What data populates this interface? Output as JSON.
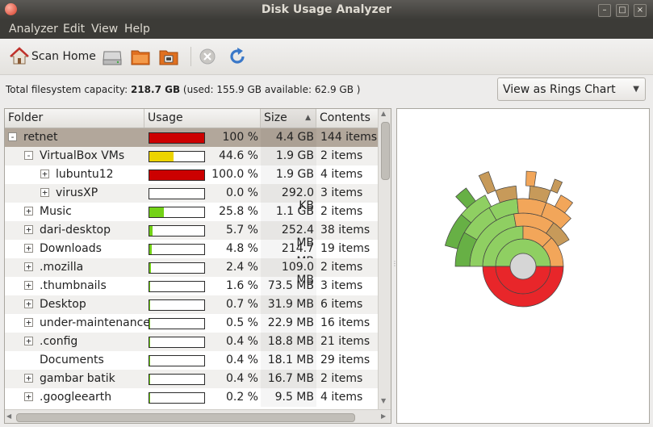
{
  "window": {
    "title": "Disk Usage Analyzer",
    "controls": [
      "–",
      "□",
      "×"
    ]
  },
  "menu": [
    "Analyzer",
    "Edit",
    "View",
    "Help"
  ],
  "toolbar": {
    "scan_home": "Scan Home"
  },
  "capacity": {
    "prefix": "Total filesystem capacity: ",
    "total": "218.7 GB",
    "detail": " (used: 155.9 GB available: 62.9 GB )"
  },
  "view_select": {
    "value": "View as Rings Chart"
  },
  "columns": [
    "Folder",
    "Usage",
    "Size",
    "Contents"
  ],
  "colors": {
    "red": "#cc0000",
    "yellow": "#edd400",
    "green": "#73d216",
    "selection": "#b2a79b"
  },
  "rows": [
    {
      "name": "retnet",
      "level": 0,
      "expander": "-",
      "fraction": 1.0,
      "color": "#cc0000",
      "percent": "100 %",
      "size": "4.4 GB",
      "contents": "144 items"
    },
    {
      "name": "VirtualBox VMs",
      "level": 1,
      "expander": "-",
      "fraction": 0.446,
      "color": "#edd400",
      "percent": "44.6 %",
      "size": "1.9 GB",
      "contents": "2 items"
    },
    {
      "name": "lubuntu12",
      "level": 2,
      "expander": "+",
      "fraction": 1.0,
      "color": "#cc0000",
      "percent": "100.0 %",
      "size": "1.9 GB",
      "contents": "4 items"
    },
    {
      "name": "virusXP",
      "level": 2,
      "expander": "+",
      "fraction": 0.0,
      "color": "#73d216",
      "percent": "0.0 %",
      "size": "292.0 KB",
      "contents": "3 items"
    },
    {
      "name": "Music",
      "level": 1,
      "expander": "+",
      "fraction": 0.258,
      "color": "#73d216",
      "percent": "25.8 %",
      "size": "1.1 GB",
      "contents": "2 items"
    },
    {
      "name": "dari-desktop",
      "level": 1,
      "expander": "+",
      "fraction": 0.057,
      "color": "#73d216",
      "percent": "5.7 %",
      "size": "252.4 MB",
      "contents": "38 items"
    },
    {
      "name": "Downloads",
      "level": 1,
      "expander": "+",
      "fraction": 0.048,
      "color": "#73d216",
      "percent": "4.8 %",
      "size": "214.7 MB",
      "contents": "19 items"
    },
    {
      "name": ".mozilla",
      "level": 1,
      "expander": "+",
      "fraction": 0.024,
      "color": "#73d216",
      "percent": "2.4 %",
      "size": "109.0 MB",
      "contents": "2 items"
    },
    {
      "name": ".thumbnails",
      "level": 1,
      "expander": "+",
      "fraction": 0.016,
      "color": "#73d216",
      "percent": "1.6 %",
      "size": "73.5 MB",
      "contents": "3 items"
    },
    {
      "name": "Desktop",
      "level": 1,
      "expander": "+",
      "fraction": 0.007,
      "color": "#73d216",
      "percent": "0.7 %",
      "size": "31.9 MB",
      "contents": "6 items"
    },
    {
      "name": "under-maintenance",
      "level": 1,
      "expander": "+",
      "fraction": 0.005,
      "color": "#73d216",
      "percent": "0.5 %",
      "size": "22.9 MB",
      "contents": "16 items"
    },
    {
      "name": ".config",
      "level": 1,
      "expander": "+",
      "fraction": 0.004,
      "color": "#73d216",
      "percent": "0.4 %",
      "size": "18.8 MB",
      "contents": "21 items"
    },
    {
      "name": "Documents",
      "level": 1,
      "expander": "",
      "fraction": 0.004,
      "color": "#73d216",
      "percent": "0.4 %",
      "size": "18.1 MB",
      "contents": "29 items"
    },
    {
      "name": "gambar batik",
      "level": 1,
      "expander": "+",
      "fraction": 0.004,
      "color": "#73d216",
      "percent": "0.4 %",
      "size": "16.7 MB",
      "contents": "2 items"
    },
    {
      "name": ".googleearth",
      "level": 1,
      "expander": "+",
      "fraction": 0.002,
      "color": "#73d216",
      "percent": "0.2 %",
      "size": "9.5 MB",
      "contents": "4 items"
    }
  ]
}
